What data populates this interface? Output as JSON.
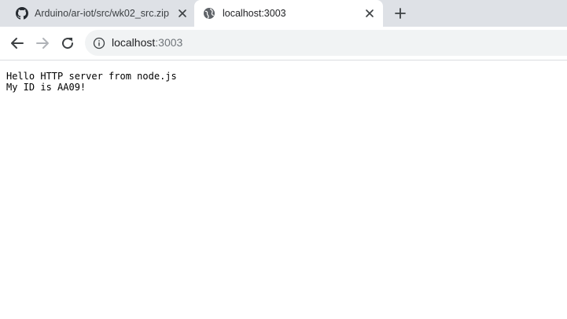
{
  "tabs": [
    {
      "title": "Arduino/ar-iot/src/wk02_src.zip",
      "icon": "github-icon",
      "active": false
    },
    {
      "title": "localhost:3003",
      "icon": "globe-icon",
      "active": true
    }
  ],
  "toolbar": {
    "url_host": "localhost",
    "url_port": ":3003"
  },
  "page": {
    "lines": [
      "Hello HTTP server from node.js",
      "My ID is AA09!"
    ]
  },
  "colors": {
    "tabstrip_bg": "#dee1e6",
    "omnibox_bg": "#f1f3f4",
    "icon_gray": "#5f6368"
  }
}
